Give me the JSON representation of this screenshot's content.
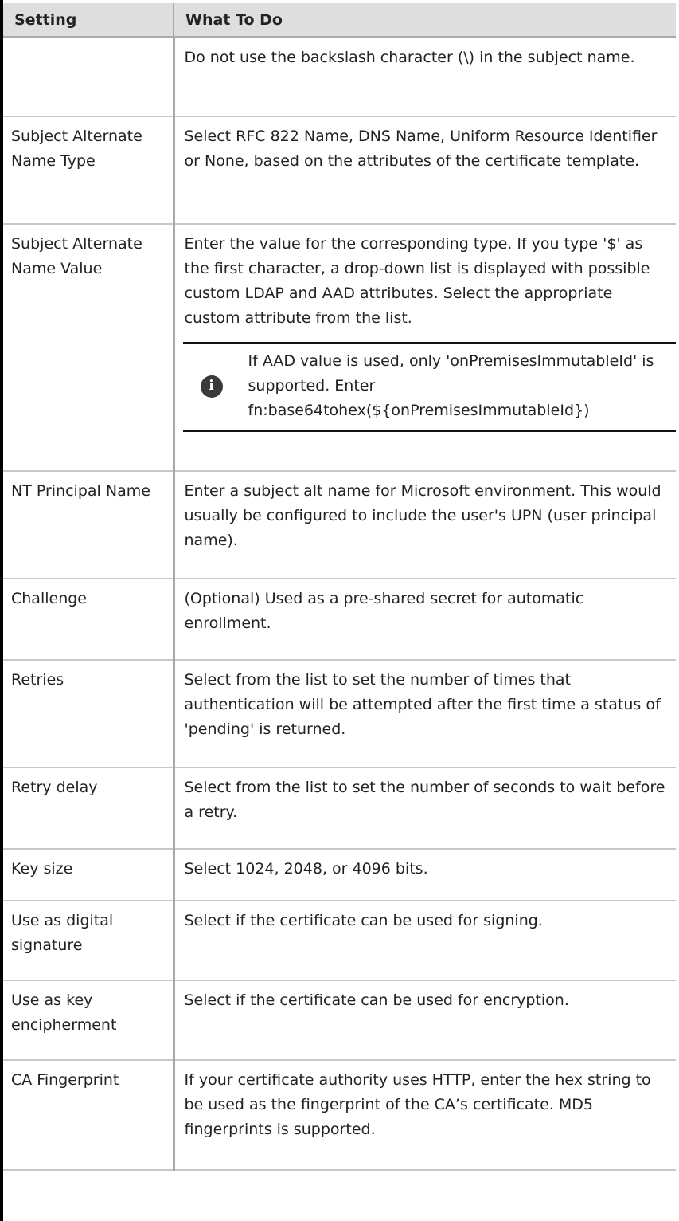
{
  "table": {
    "headers": [
      "Setting",
      "What To Do"
    ],
    "rows": [
      {
        "setting": "",
        "todo": "Do not use the backslash character (\\) in the subject name."
      },
      {
        "setting": "Subject Alternate Name Type",
        "todo": "Select RFC 822 Name, DNS Name, Uniform Resource Identifier or None, based on the attributes of the certificate template."
      },
      {
        "setting": "Subject Alternate Name Value",
        "todo": "Enter the value for the corresponding type. If you type '$' as the first character, a drop-down list is displayed with possible custom LDAP and AAD attributes. Select the appropriate custom attribute from the list.",
        "note": "If AAD value is used, only 'onPremisesImmutableId' is supported. Enter fn:base64tohex(${onPremisesImmutableId})"
      },
      {
        "setting": "NT Principal Name",
        "todo": "Enter a subject alt name for Microsoft environment. This would usually be configured to include the user's UPN (user principal name)."
      },
      {
        "setting": "Challenge",
        "todo": "(Optional) Used as a pre-shared secret for automatic enrollment."
      },
      {
        "setting": "Retries",
        "todo": "Select from the list to set the number of times that authentication will be attempted after the first time a status of 'pending' is returned."
      },
      {
        "setting": "Retry delay",
        "todo": "Select from the list to set the number of seconds to wait before a retry."
      },
      {
        "setting": "Key size",
        "todo": "Select 1024, 2048, or 4096 bits."
      },
      {
        "setting": "Use as digital signature",
        "todo": "Select if the certificate can be used for signing."
      },
      {
        "setting": "Use as key encipherment",
        "todo": "Select if the certificate can be used for encryption."
      },
      {
        "setting": "CA Fingerprint",
        "todo": "If your certificate authority uses HTTP, enter the hex string to be used as the fingerprint of the CA’s certificate. MD5 fingerprints is supported."
      }
    ]
  },
  "icons": {
    "note": "info-icon",
    "note_glyph": "i"
  },
  "colors": {
    "header_bg": "#dedede",
    "note_icon": "#3a3a3a"
  }
}
